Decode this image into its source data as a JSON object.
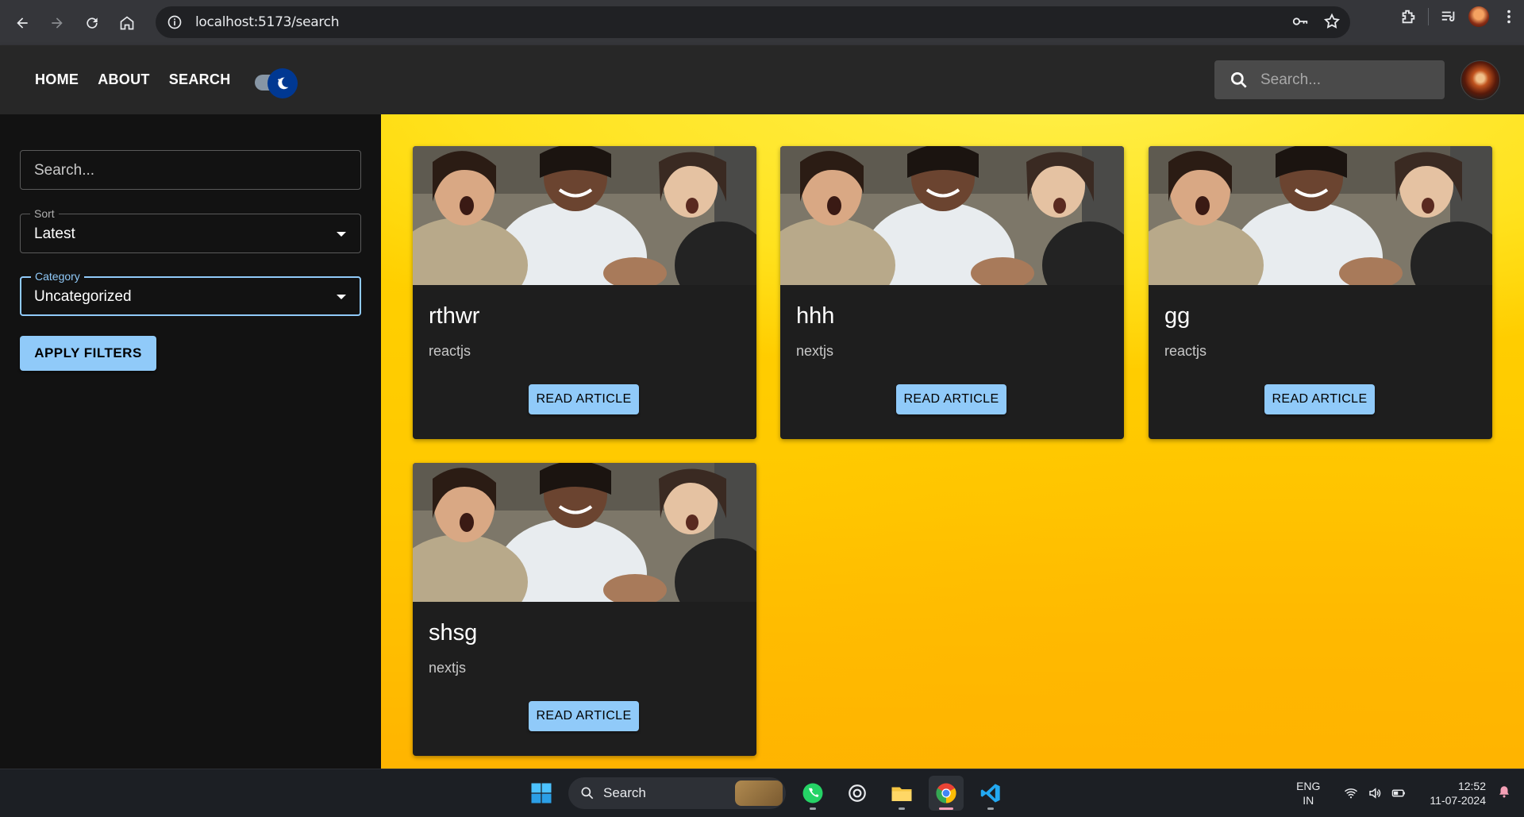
{
  "browser": {
    "url": "localhost:5173/search"
  },
  "header": {
    "nav": [
      {
        "label": "HOME"
      },
      {
        "label": "ABOUT"
      },
      {
        "label": "SEARCH"
      }
    ],
    "search_placeholder": "Search...",
    "theme_toggle": "dark"
  },
  "sidebar": {
    "search_placeholder": "Search...",
    "sort": {
      "legend": "Sort",
      "value": "Latest"
    },
    "category": {
      "legend": "Category",
      "value": "Uncategorized"
    },
    "apply_label": "APPLY FILTERS"
  },
  "posts": [
    {
      "title": "rthwr",
      "category": "reactjs",
      "button": "READ ARTICLE"
    },
    {
      "title": "hhh",
      "category": "nextjs",
      "button": "READ ARTICLE"
    },
    {
      "title": "gg",
      "category": "reactjs",
      "button": "READ ARTICLE"
    },
    {
      "title": "shsg",
      "category": "nextjs",
      "button": "READ ARTICLE"
    }
  ],
  "taskbar": {
    "search_label": "Search",
    "lang_line1": "ENG",
    "lang_line2": "IN",
    "time": "12:52",
    "date": "11-07-2024"
  },
  "colors": {
    "accent": "#90caf9",
    "background": "#ffd400",
    "card": "#1e1e1e"
  }
}
